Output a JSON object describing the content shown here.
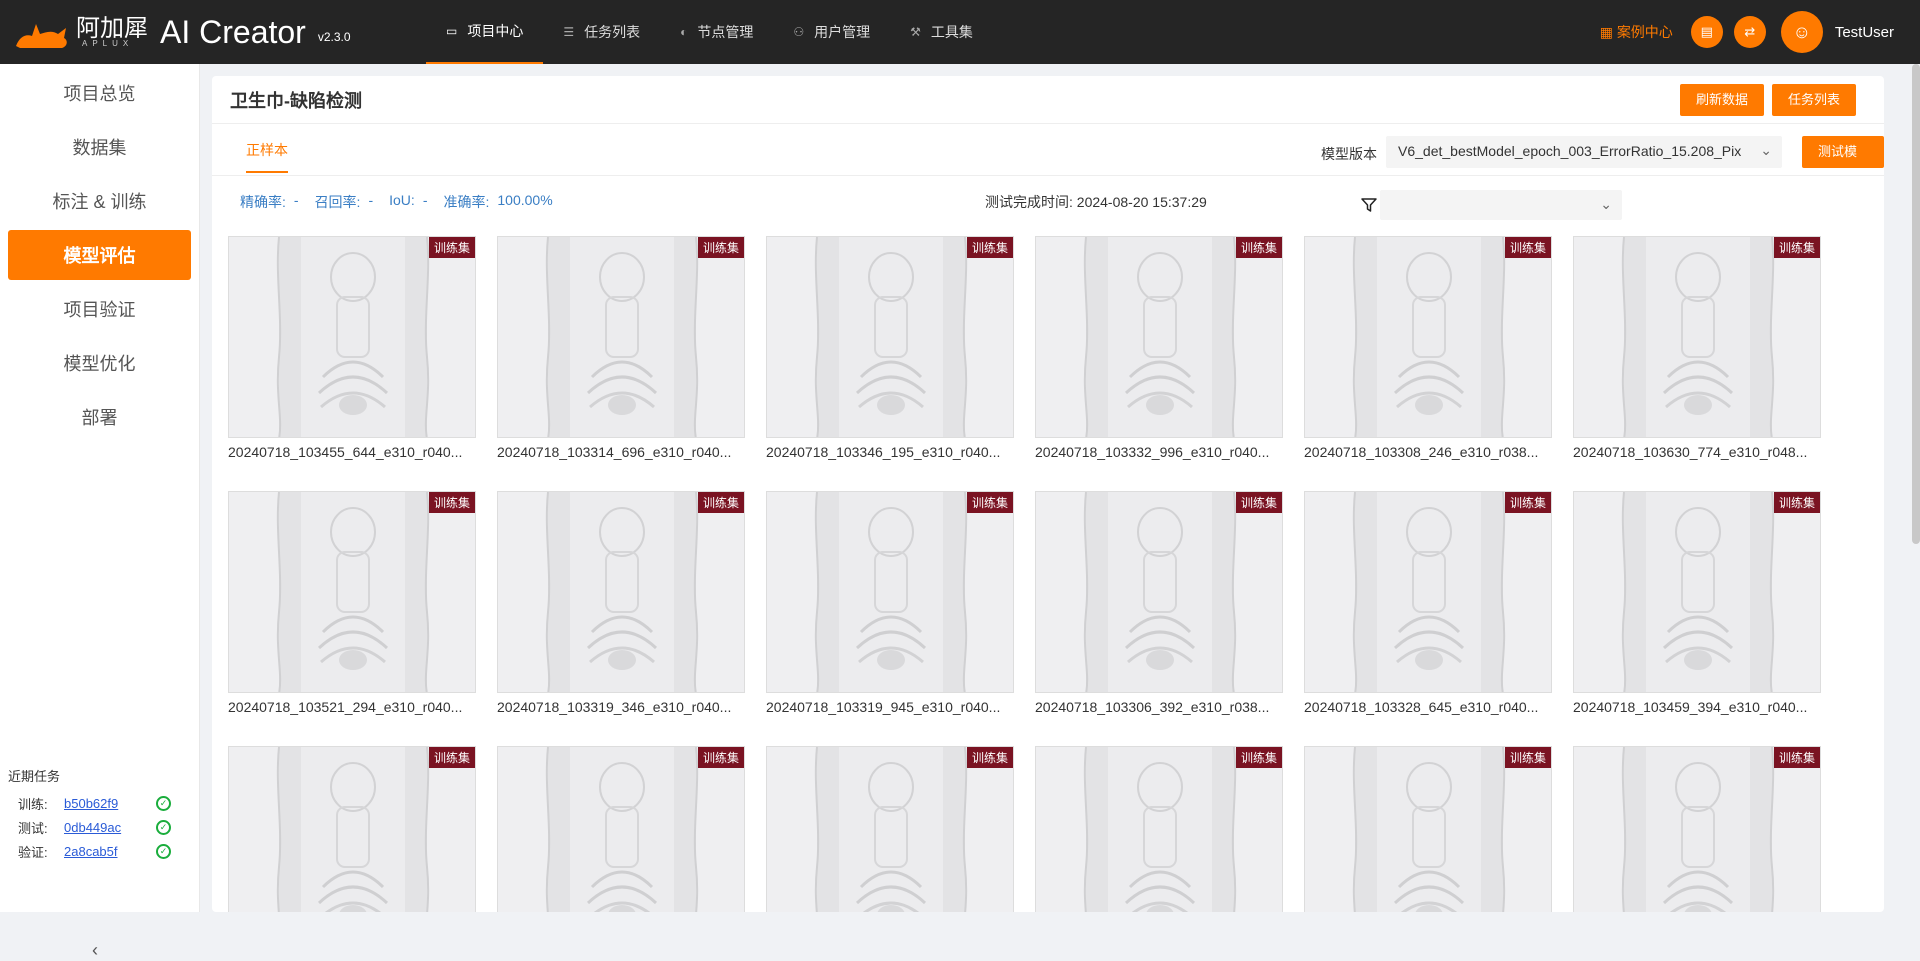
{
  "header": {
    "logo_cn": "阿加犀",
    "logo_en": "APLUX",
    "app_name": "AI Creator",
    "version": "v2.3.0",
    "nav": [
      {
        "label": "项目中心",
        "icon": "folder-icon",
        "active": true
      },
      {
        "label": "任务列表",
        "icon": "list-icon",
        "active": false
      },
      {
        "label": "节点管理",
        "icon": "node-icon",
        "active": false
      },
      {
        "label": "用户管理",
        "icon": "users-icon",
        "active": false
      },
      {
        "label": "工具集",
        "icon": "wrench-icon",
        "active": false
      }
    ],
    "cases_label": "案例中心",
    "username": "TestUser"
  },
  "sidebar": {
    "items": [
      {
        "label": "项目总览"
      },
      {
        "label": "数据集"
      },
      {
        "label": "标注 & 训练"
      },
      {
        "label": "模型评估",
        "active": true
      },
      {
        "label": "项目验证"
      },
      {
        "label": "模型优化"
      },
      {
        "label": "部署"
      }
    ],
    "recent_title": "近期任务",
    "recent": [
      {
        "label": "训练:",
        "id": "b50b62f9"
      },
      {
        "label": "测试:",
        "id": "0db449ac"
      },
      {
        "label": "验证:",
        "id": "2a8cab5f"
      }
    ]
  },
  "main": {
    "title": "卫生巾-缺陷检测",
    "refresh_label": "刷新数据",
    "tasks_label": "任务列表",
    "tab_label": "正样本",
    "model_version_label": "模型版本",
    "model_version_value": "V6_det_bestModel_epoch_003_ErrorRatio_15.208_Pix",
    "test_model_label": "测试模型",
    "metrics": {
      "precision_label": "精确率:",
      "precision_value": "-",
      "recall_label": "召回率:",
      "recall_value": "-",
      "iou_label": "IoU:",
      "iou_value": "-",
      "accuracy_label": "准确率:",
      "accuracy_value": "100.00%"
    },
    "done_time_label": "测试完成时间:",
    "done_time_value": "2024-08-20 15:37:29",
    "tag_label": "训练集",
    "images": [
      "20240718_103455_644_e310_r040...",
      "20240718_103314_696_e310_r040...",
      "20240718_103346_195_e310_r040...",
      "20240718_103332_996_e310_r040...",
      "20240718_103308_246_e310_r038...",
      "20240718_103630_774_e310_r048...",
      "20240718_103521_294_e310_r040...",
      "20240718_103319_346_e310_r040...",
      "20240718_103319_945_e310_r040...",
      "20240718_103306_392_e310_r038...",
      "20240718_103328_645_e310_r040...",
      "20240718_103459_394_e310_r040...",
      "",
      "",
      "",
      "",
      "",
      ""
    ]
  }
}
